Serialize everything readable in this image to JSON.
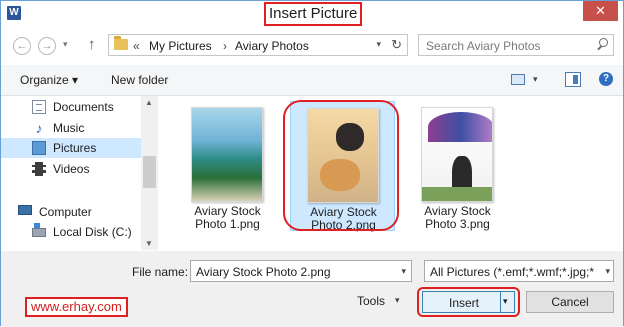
{
  "window": {
    "title": "Insert Picture",
    "app_icon_letter": "W",
    "close_symbol": "✕"
  },
  "nav": {
    "back_symbol": "←",
    "forward_symbol": "→",
    "recent_symbol": "▾",
    "up_symbol": "↑",
    "breadcrumb_prefix": "«",
    "breadcrumbs": [
      "My Pictures",
      "Aviary Photos"
    ],
    "breadcrumb_separator": "›",
    "address_dropdown_symbol": "▾",
    "refresh_symbol": "↻",
    "search_placeholder": "Search Aviary Photos"
  },
  "toolbar": {
    "organize_label": "Organize ▾",
    "new_folder_label": "New folder",
    "view_dropdown_symbol": "▾",
    "help_symbol": "?"
  },
  "sidebar": {
    "items": [
      {
        "label": "Documents",
        "icon": "documents-icon"
      },
      {
        "label": "Music",
        "icon": "music-icon"
      },
      {
        "label": "Pictures",
        "icon": "pictures-icon",
        "selected": true
      },
      {
        "label": "Videos",
        "icon": "videos-icon"
      },
      {
        "label": "Computer",
        "icon": "computer-icon"
      },
      {
        "label": "Local Disk (C:)",
        "icon": "disk-icon"
      }
    ],
    "scroll_up_symbol": "▲",
    "scroll_down_symbol": "▼"
  },
  "files": [
    {
      "line1": "Aviary Stock",
      "line2": "Photo 1.png",
      "selected": false
    },
    {
      "line1": "Aviary Stock",
      "line2": "Photo 2.png",
      "selected": true
    },
    {
      "line1": "Aviary Stock",
      "line2": "Photo 3.png",
      "selected": false
    }
  ],
  "bottom": {
    "file_name_label": "File name:",
    "file_name_value": "Aviary Stock Photo 2.png",
    "dropdown_symbol": "▾",
    "filter_value": "All Pictures (*.emf;*.wmf;*.jpg;*",
    "tools_label": "Tools",
    "insert_label": "Insert",
    "cancel_label": "Cancel",
    "website": "www.erhay.com"
  },
  "colors": {
    "annotation_red": "#e02020",
    "selection_blue": "#cde8ff",
    "close_red": "#c7504a"
  }
}
